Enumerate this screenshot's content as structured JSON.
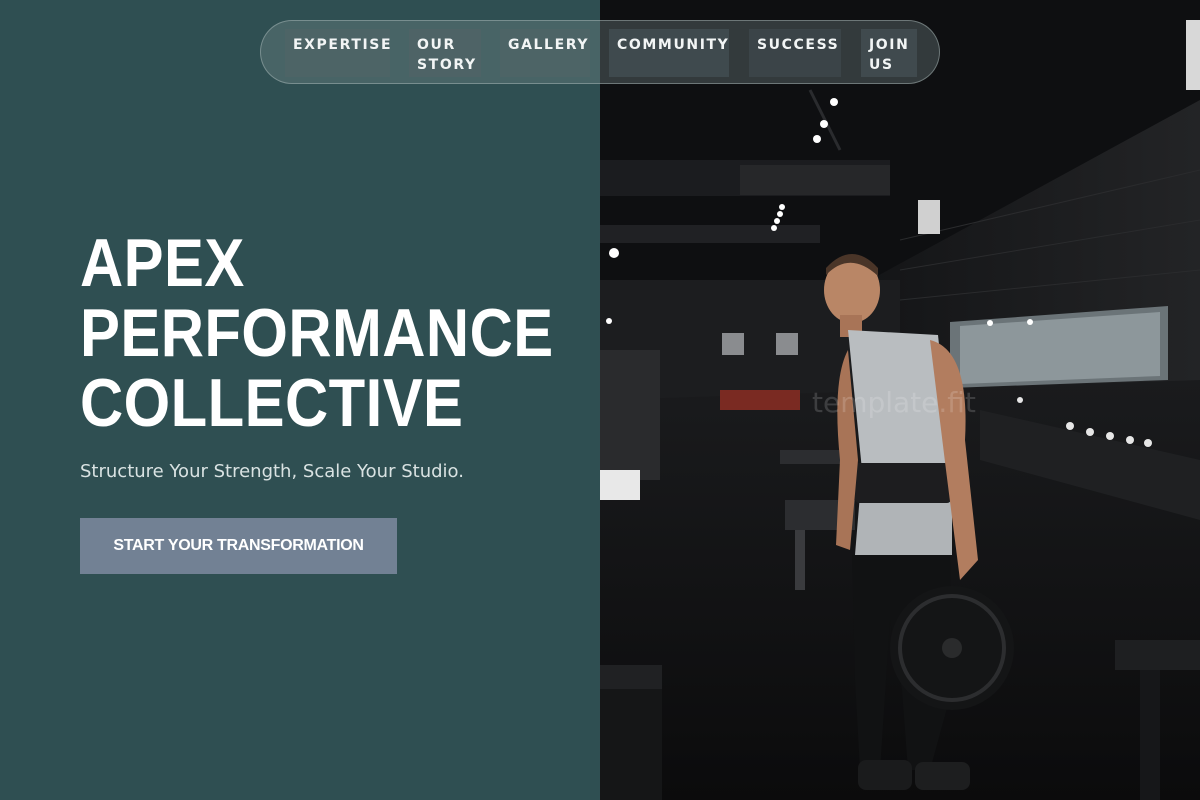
{
  "nav": {
    "items": [
      {
        "label": "EXPERTISE"
      },
      {
        "label": "OUR\nSTORY"
      },
      {
        "label": "GALLERY"
      },
      {
        "label": "COMMUNITY"
      },
      {
        "label": "SUCCESS"
      },
      {
        "label": "JOIN\nUS"
      }
    ]
  },
  "hero": {
    "title_lines": [
      "APEX",
      "PERFORMANCE",
      "COLLECTIVE"
    ],
    "subtitle": "Structure Your Strength, Scale Your Studio.",
    "cta_label": "START YOUR TRANSFORMATION"
  },
  "photo": {
    "watermark": "template.fit"
  },
  "colors": {
    "panel": "#2f4f52",
    "cta": "#728194",
    "text": "#ffffff"
  }
}
